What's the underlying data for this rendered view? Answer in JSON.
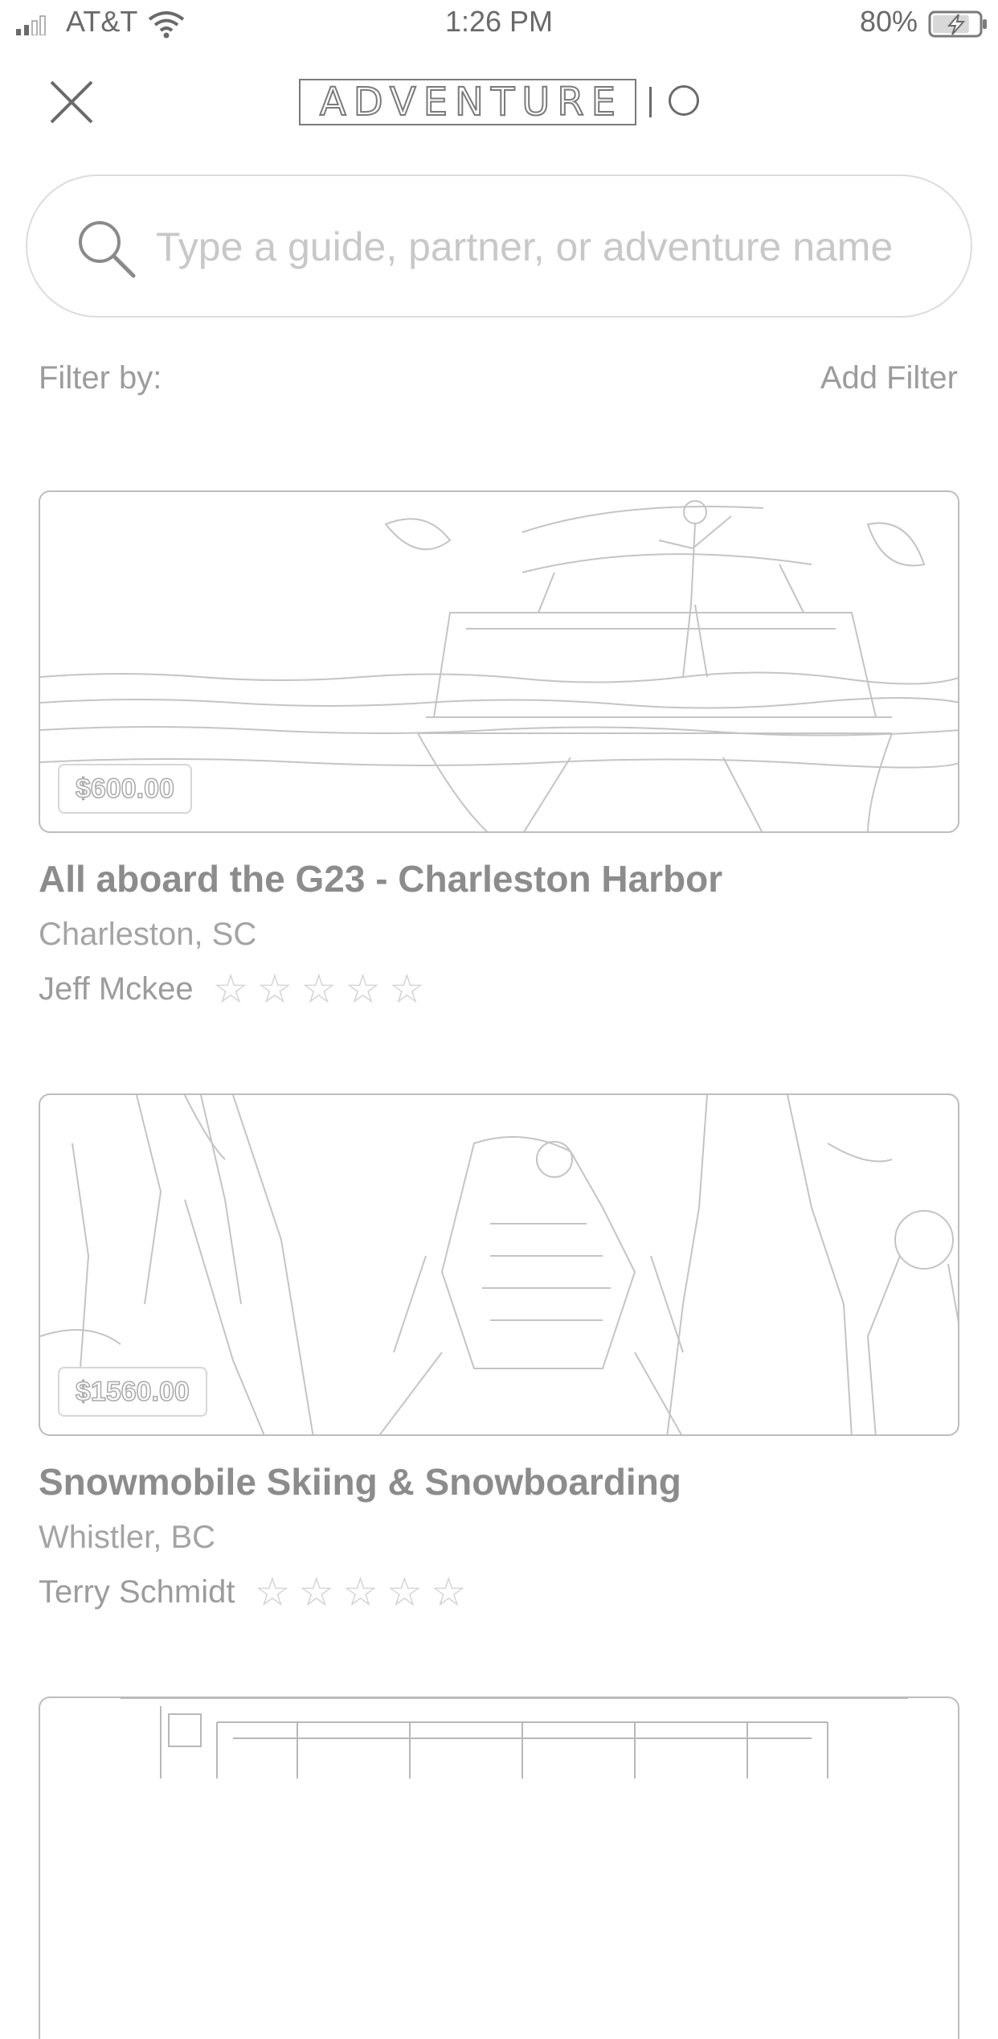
{
  "status_bar": {
    "carrier": "AT&T",
    "time": "1:26 PM",
    "battery_percent": "80%",
    "battery_level": 0.8,
    "icons": [
      "signal-icon",
      "wifi-icon",
      "battery-charging-icon"
    ]
  },
  "header": {
    "logo_text": "ADVENTURE",
    "close_icon": "close-icon"
  },
  "search": {
    "placeholder": "Type a guide, partner, or adventure name",
    "value": "",
    "icon": "search-icon"
  },
  "filter": {
    "label": "Filter by:",
    "add_label": "Add Filter"
  },
  "listings": [
    {
      "price": "$600.00",
      "title": "All aboard the G23 - Charleston Harbor",
      "location": "Charleston, SC",
      "guide": "Jeff Mckee",
      "rating": 0,
      "rating_max": 5,
      "image": "boat-photo"
    },
    {
      "price": "$1560.00",
      "title": "Snowmobile Skiing & Snowboarding",
      "location": "Whistler, BC",
      "guide": "Terry Schmidt",
      "rating": 0,
      "rating_max": 5,
      "image": "snowmobile-photo"
    },
    {
      "image": "cabin-photo"
    }
  ],
  "colors": {
    "text_primary": "#8c8c8c",
    "text_secondary": "#a4a4a4",
    "border": "#bdbdbd",
    "star_empty": "#d2d2d2",
    "placeholder": "#c8c8c8"
  }
}
